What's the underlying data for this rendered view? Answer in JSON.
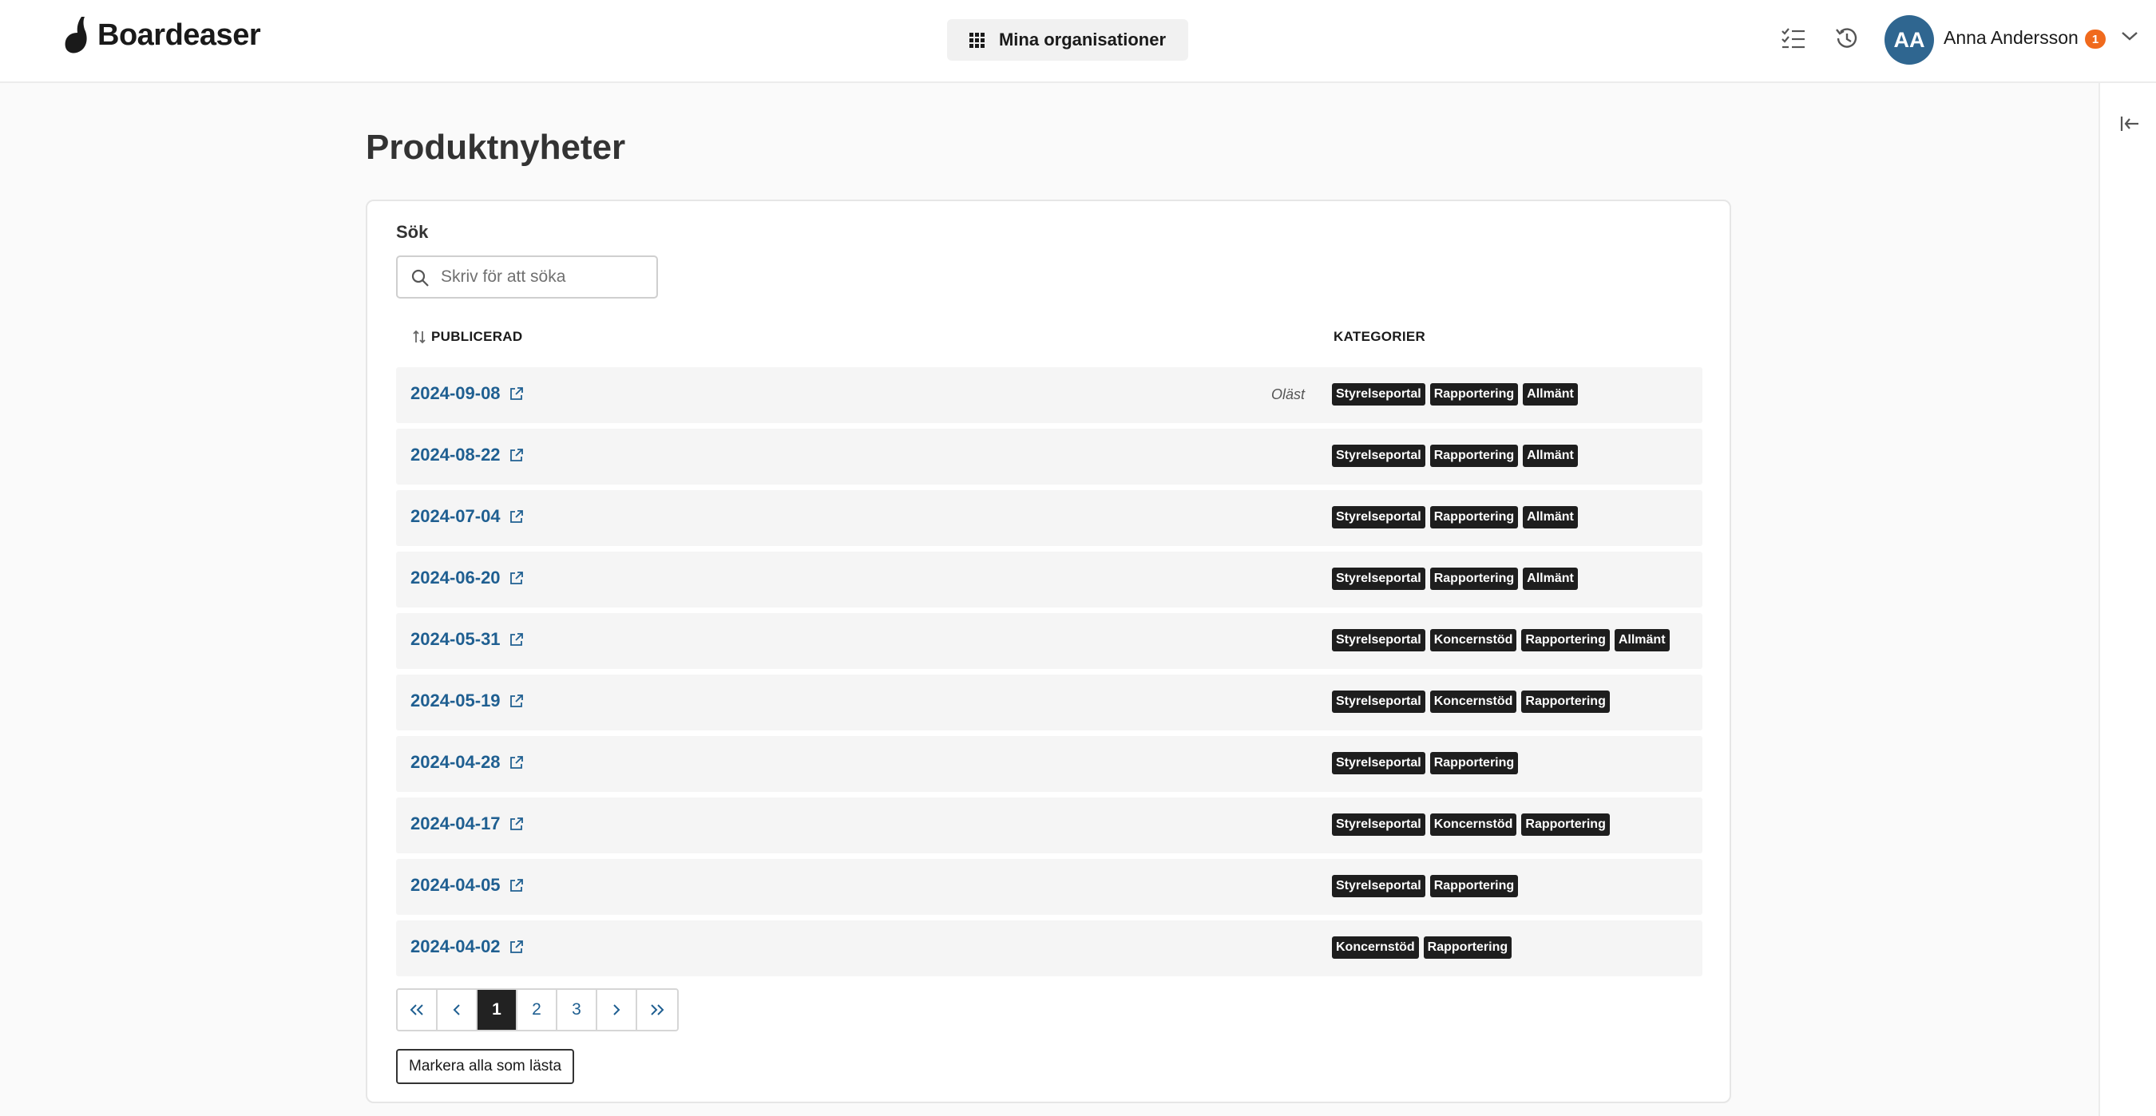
{
  "header": {
    "logo_text": "Boardeaser",
    "org_button_label": "Mina organisationer",
    "user": {
      "initials": "AA",
      "name": "Anna Andersson",
      "notification_count": "1"
    }
  },
  "page": {
    "title": "Produktnyheter"
  },
  "search": {
    "label": "Sök",
    "placeholder": "Skriv för att söka",
    "value": ""
  },
  "table": {
    "columns": {
      "published": "PUBLICERAD",
      "categories": "KATEGORIER"
    },
    "rows": [
      {
        "date": "2024-09-08",
        "status": "Oläst",
        "categories": [
          "Styrelseportal",
          "Rapportering",
          "Allmänt"
        ]
      },
      {
        "date": "2024-08-22",
        "status": "",
        "categories": [
          "Styrelseportal",
          "Rapportering",
          "Allmänt"
        ]
      },
      {
        "date": "2024-07-04",
        "status": "",
        "categories": [
          "Styrelseportal",
          "Rapportering",
          "Allmänt"
        ]
      },
      {
        "date": "2024-06-20",
        "status": "",
        "categories": [
          "Styrelseportal",
          "Rapportering",
          "Allmänt"
        ]
      },
      {
        "date": "2024-05-31",
        "status": "",
        "categories": [
          "Styrelseportal",
          "Koncernstöd",
          "Rapportering",
          "Allmänt"
        ]
      },
      {
        "date": "2024-05-19",
        "status": "",
        "categories": [
          "Styrelseportal",
          "Koncernstöd",
          "Rapportering"
        ]
      },
      {
        "date": "2024-04-28",
        "status": "",
        "categories": [
          "Styrelseportal",
          "Rapportering"
        ]
      },
      {
        "date": "2024-04-17",
        "status": "",
        "categories": [
          "Styrelseportal",
          "Koncernstöd",
          "Rapportering"
        ]
      },
      {
        "date": "2024-04-05",
        "status": "",
        "categories": [
          "Styrelseportal",
          "Rapportering"
        ]
      },
      {
        "date": "2024-04-02",
        "status": "",
        "categories": [
          "Koncernstöd",
          "Rapportering"
        ]
      }
    ]
  },
  "pagination": {
    "first": "«",
    "prev": "‹",
    "pages": [
      "1",
      "2",
      "3"
    ],
    "current": "1",
    "next": "›",
    "last": "»"
  },
  "actions": {
    "mark_all_read": "Markera alla som lästa"
  },
  "colors": {
    "link": "#1f5f91",
    "avatar": "#2f6690",
    "badge": "#f06a1d",
    "tag": "#1e1e1e"
  },
  "icons": {
    "org_button": "grid-icon",
    "checklist": "checklist-icon",
    "history": "history-icon",
    "chevron": "chevron-down-icon",
    "collapse": "collapse-panel-icon",
    "search": "search-icon",
    "sort": "sort-icon",
    "external": "external-link-icon"
  }
}
